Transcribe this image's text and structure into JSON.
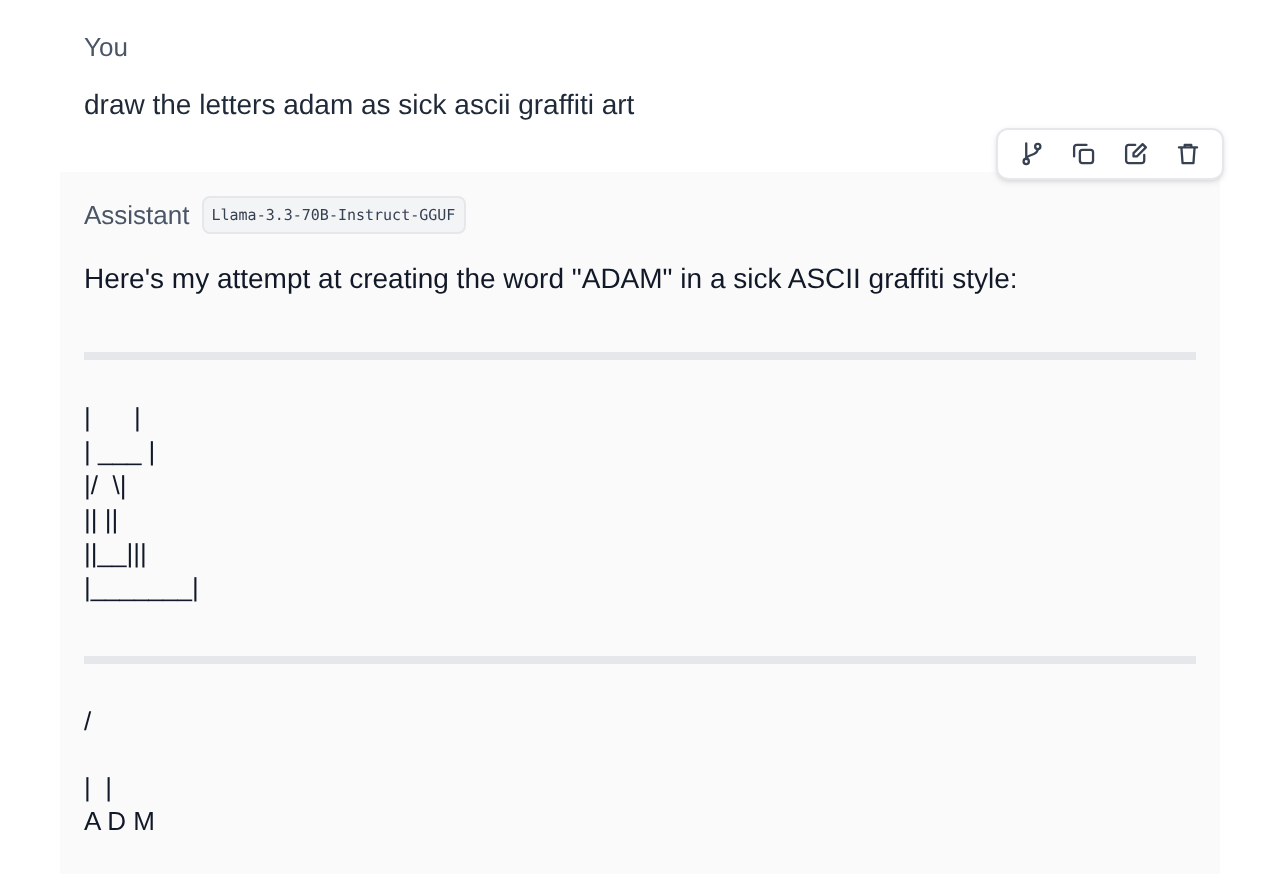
{
  "user_message": {
    "author": "You",
    "text": "draw the letters adam as sick ascii graffiti art"
  },
  "toolbar": [
    {
      "kind": "branch"
    },
    {
      "kind": "copy"
    },
    {
      "kind": "edit"
    },
    {
      "kind": "delete"
    }
  ],
  "assistant_message": {
    "author": "Assistant",
    "model": "Llama-3.3-70B-Instruct-GGUF",
    "intro": "Here's my attempt at creating the word \"ADAM\" in a sick ASCII graffiti style:",
    "blocks": [
      {
        "kind": "rule"
      },
      {
        "kind": "ascii",
        "lines": [
          "|      |",
          "| ___ |",
          "|/  \\|",
          "|| ||",
          "||__|||",
          "|_______|"
        ]
      },
      {
        "kind": "rule"
      },
      {
        "kind": "ascii",
        "lines": [
          "/"
        ]
      },
      {
        "kind": "ascii",
        "lines": [
          "|  |",
          "A D M"
        ]
      }
    ]
  }
}
